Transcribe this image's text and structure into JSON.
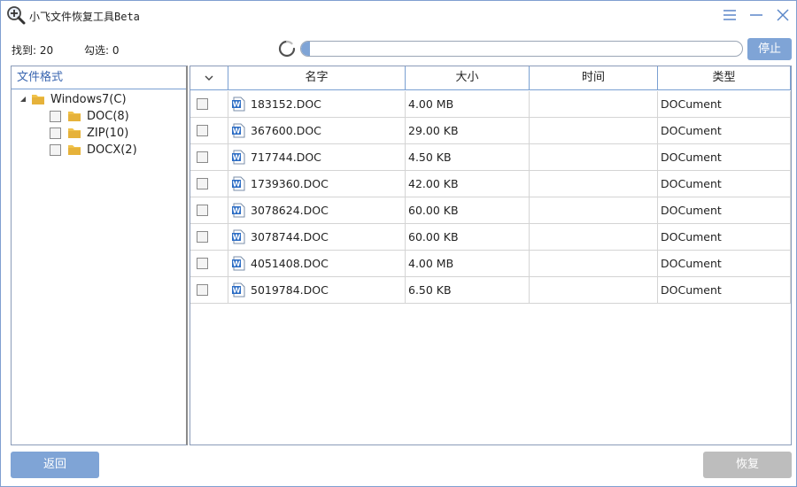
{
  "window": {
    "title": "小飞文件恢复工具Beta",
    "icon": "magnifier-plus-icon"
  },
  "colors": {
    "accent": "#7fa4d6",
    "header_text": "#3a66b0",
    "disabled_button": "#bdbdbd"
  },
  "stats": {
    "found_label": "找到:",
    "found_value": "20",
    "checked_label": "勾选:",
    "checked_value": "0"
  },
  "scan": {
    "progress_fraction": 0.02,
    "stop_label": "停止"
  },
  "tree": {
    "header": "文件格式",
    "root": {
      "label": "Windows7(C)",
      "expanded": true
    },
    "children": [
      {
        "label": "DOC(8)",
        "checked": false
      },
      {
        "label": "ZIP(10)",
        "checked": false
      },
      {
        "label": "DOCX(2)",
        "checked": false
      }
    ]
  },
  "table": {
    "columns": [
      "名字",
      "大小",
      "时间",
      "类型"
    ],
    "rows": [
      {
        "name": "183152.DOC",
        "size": "4.00 MB",
        "time": "",
        "type": "DOCument",
        "checked": false
      },
      {
        "name": "367600.DOC",
        "size": "29.00 KB",
        "time": "",
        "type": "DOCument",
        "checked": false
      },
      {
        "name": "717744.DOC",
        "size": "4.50 KB",
        "time": "",
        "type": "DOCument",
        "checked": false
      },
      {
        "name": "1739360.DOC",
        "size": "42.00 KB",
        "time": "",
        "type": "DOCument",
        "checked": false
      },
      {
        "name": "3078624.DOC",
        "size": "60.00 KB",
        "time": "",
        "type": "DOCument",
        "checked": false
      },
      {
        "name": "3078744.DOC",
        "size": "60.00 KB",
        "time": "",
        "type": "DOCument",
        "checked": false
      },
      {
        "name": "4051408.DOC",
        "size": "4.00 MB",
        "time": "",
        "type": "DOCument",
        "checked": false
      },
      {
        "name": "5019784.DOC",
        "size": "6.50 KB",
        "time": "",
        "type": "DOCument",
        "checked": false
      }
    ]
  },
  "footer": {
    "back_label": "返回",
    "recover_label": "恢复"
  }
}
